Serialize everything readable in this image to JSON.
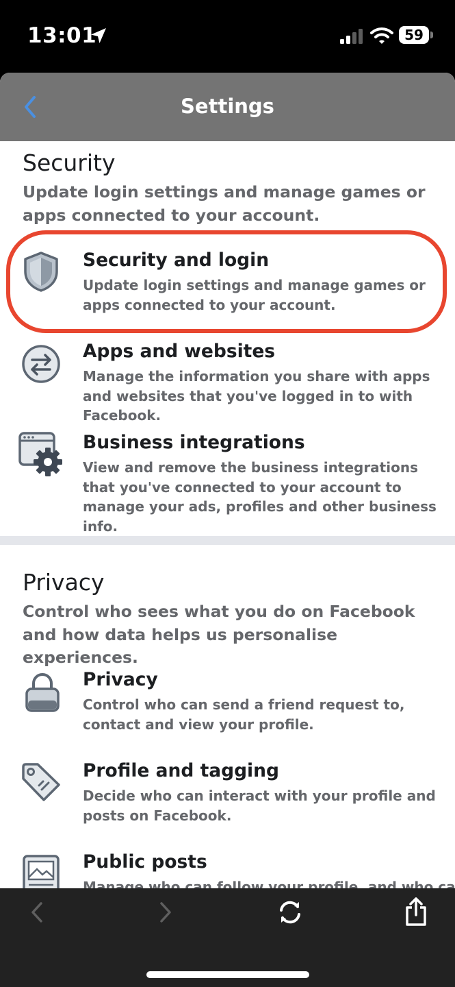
{
  "status_bar": {
    "time": "13:01",
    "battery": "59",
    "icons": [
      "location-arrow-icon",
      "cellular-signal-icon",
      "wifi-icon",
      "battery-icon"
    ]
  },
  "navbar": {
    "title": "Settings",
    "back_icon": "chevron-left-icon",
    "accent_color": "#4a90e2"
  },
  "security": {
    "title": "Security",
    "description": "Update login settings and manage games or apps connected to your account.",
    "items": [
      {
        "icon": "shield-icon",
        "title": "Security and login",
        "description": "Update login settings and manage games or apps connected to your account.",
        "highlighted": true
      },
      {
        "icon": "arrows-exchange-icon",
        "title": "Apps and websites",
        "description": "Manage the information you share with apps and websites that you've logged in to with Facebook."
      },
      {
        "icon": "browser-gear-icon",
        "title": "Business integrations",
        "description": "View and remove the business integrations that you've connected to your account to manage your ads, profiles and other business info."
      }
    ]
  },
  "privacy": {
    "title": "Privacy",
    "description": "Control who sees what you do on Facebook and how data helps us personalise experiences.",
    "items": [
      {
        "icon": "padlock-icon",
        "title": "Privacy",
        "description": "Control who can send a friend request to, contact and view your profile."
      },
      {
        "icon": "tag-icon",
        "title": "Profile and tagging",
        "description": "Decide who can interact with your profile and posts on Facebook."
      },
      {
        "icon": "image-frame-icon",
        "title": "Public posts",
        "description": "Manage who can follow your profile, and who can"
      }
    ]
  },
  "highlight_color": "#e8462f",
  "toolbar": {
    "icons": [
      "back-arrow-icon",
      "forward-arrow-icon",
      "refresh-icon",
      "share-icon"
    ]
  }
}
